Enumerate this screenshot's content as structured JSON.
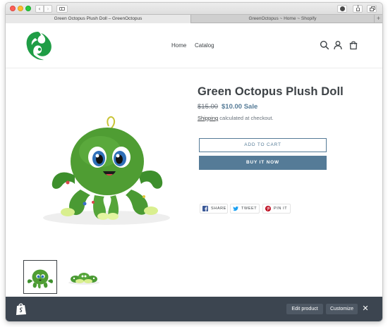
{
  "browser": {
    "tabs": [
      {
        "label": "Green Octopus Plush Doll – GreenOctopus",
        "active": true
      },
      {
        "label": "GreenOctopus ~ Home ~ Shopify",
        "active": false
      }
    ],
    "new_tab_label": "+",
    "back_label": "‹",
    "forward_label": "›"
  },
  "header": {
    "logo_icon": "green-octopus-logo",
    "nav": [
      {
        "label": "Home"
      },
      {
        "label": "Catalog"
      }
    ],
    "icons": [
      "search-icon",
      "account-icon",
      "cart-icon"
    ]
  },
  "product": {
    "title": "Green Octopus Plush Doll",
    "regular_price": "$15.00",
    "sale_price": "$10.00 Sale",
    "shipping_link": "Shipping",
    "shipping_text": " calculated at checkout.",
    "add_to_cart_label": "ADD TO CART",
    "buy_now_label": "BUY IT NOW",
    "share": [
      {
        "label": "SHARE",
        "icon": "facebook-icon"
      },
      {
        "label": "TWEET",
        "icon": "twitter-icon"
      },
      {
        "label": "PIN IT",
        "icon": "pinterest-icon"
      }
    ]
  },
  "adminbar": {
    "logo_icon": "shopify-bag-icon",
    "edit_label": "Edit product",
    "customize_label": "Customize",
    "close_label": "✕"
  },
  "colors": {
    "accent": "#557b97",
    "text": "#3d4246",
    "admin_bg": "#3c4550",
    "logo_green": "#1f9d45"
  }
}
